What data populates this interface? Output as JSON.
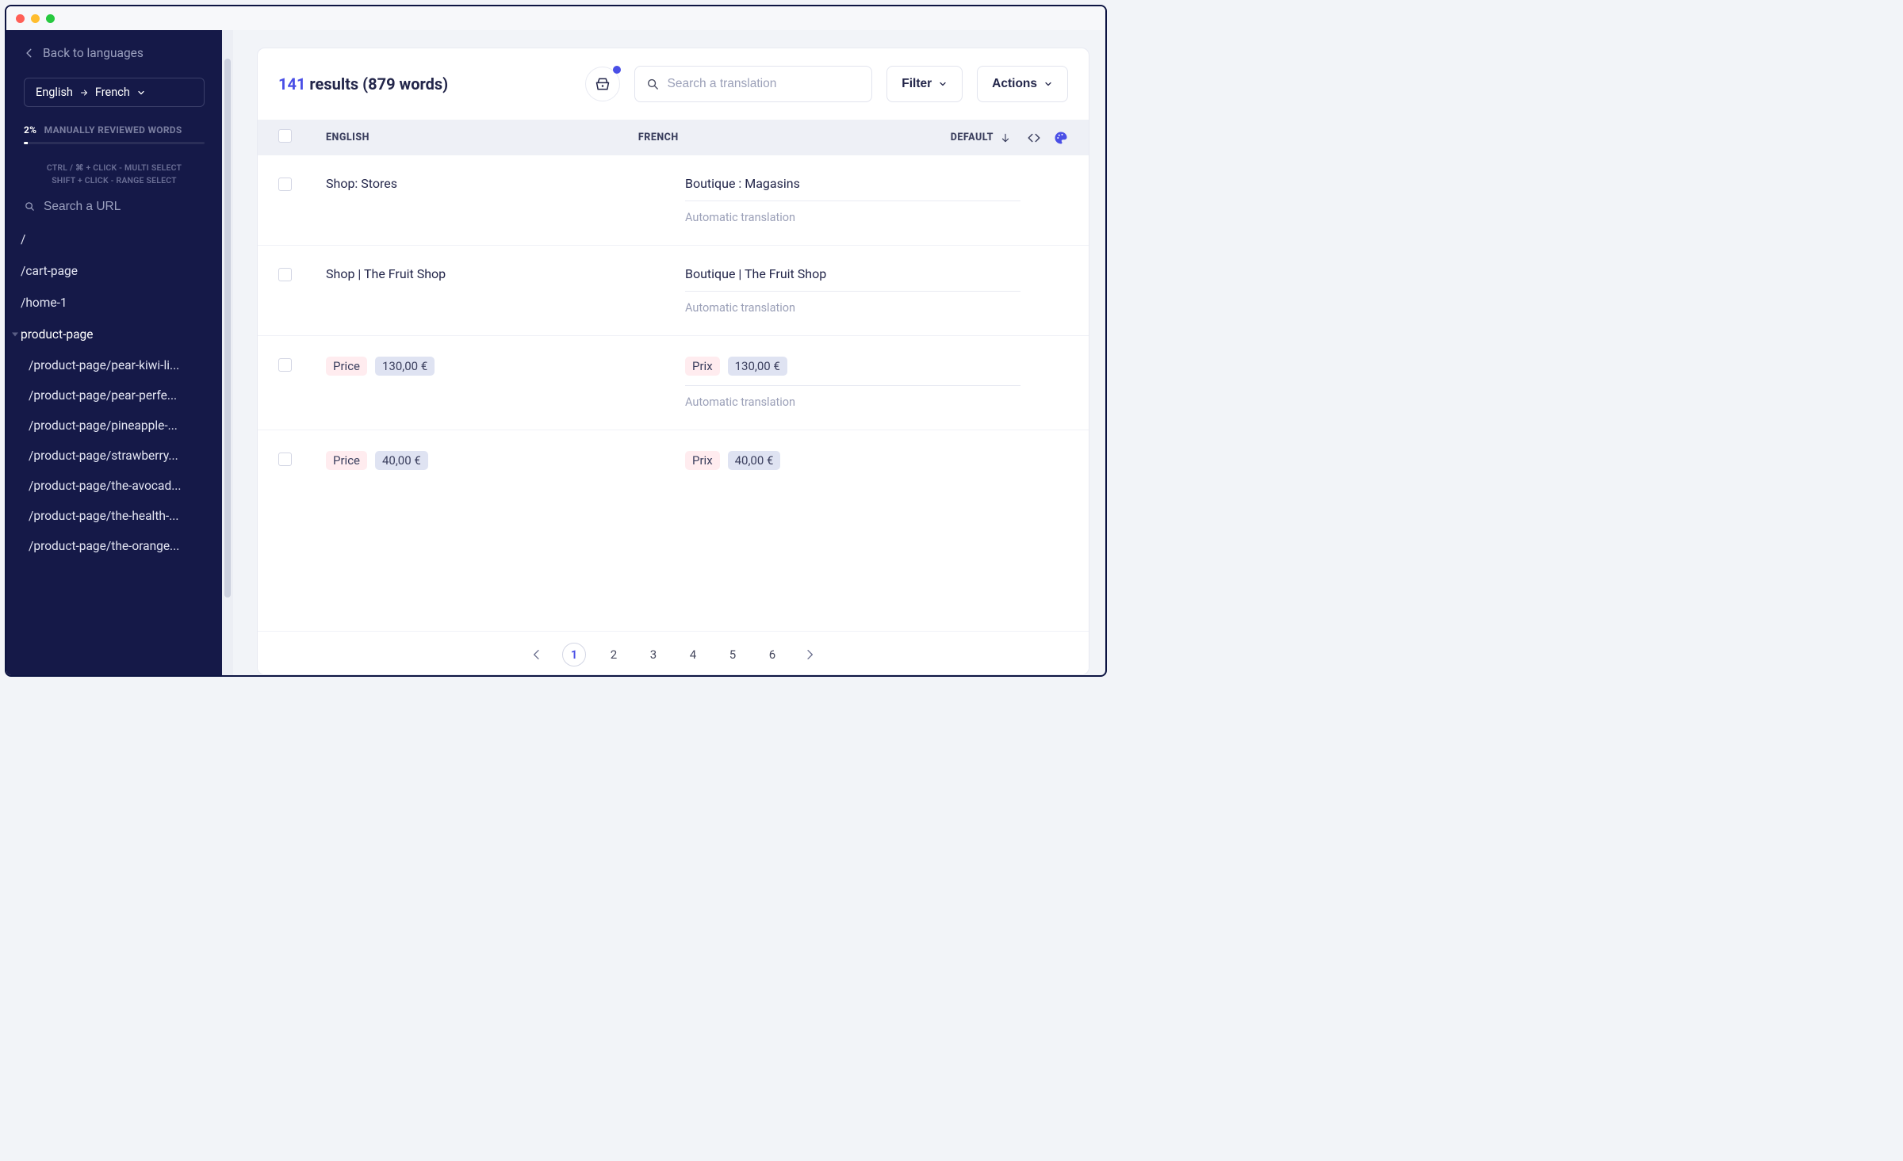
{
  "sidebar": {
    "back_label": "Back to languages",
    "lang_from": "English",
    "lang_to": "French",
    "progress_pct": "2%",
    "progress_label": "MANUALLY REVIEWED WORDS",
    "hint_line1": "CTRL / ⌘ + CLICK - MULTI SELECT",
    "hint_line2": "SHIFT + CLICK - RANGE SELECT",
    "url_search_placeholder": "Search a URL",
    "urls": [
      "/",
      "/cart-page",
      "/home-1"
    ],
    "expanded_label": "product-page",
    "children": [
      "/product-page/pear-kiwi-li...",
      "/product-page/pear-perfe...",
      "/product-page/pineapple-...",
      "/product-page/strawberry...",
      "/product-page/the-avocad...",
      "/product-page/the-health-...",
      "/product-page/the-orange..."
    ]
  },
  "header": {
    "count": "141",
    "results_text": "results (879 words)",
    "search_placeholder": "Search a translation",
    "filter_label": "Filter",
    "actions_label": "Actions"
  },
  "table": {
    "col_english": "ENGLISH",
    "col_french": "FRENCH",
    "col_default": "DEFAULT"
  },
  "rows": [
    {
      "en_text": "Shop: Stores",
      "fr_text": "Boutique : Magasins",
      "sub": "Automatic translation",
      "pill": false
    },
    {
      "en_text": "Shop | The Fruit Shop",
      "fr_text": "Boutique | The Fruit Shop",
      "sub": "Automatic translation",
      "pill": false
    },
    {
      "en_word": "Price",
      "en_num": "130,00 €",
      "fr_word": "Prix",
      "fr_num": "130,00 €",
      "sub": "Automatic translation",
      "pill": true
    },
    {
      "en_word": "Price",
      "en_num": "40,00 €",
      "fr_word": "Prix",
      "fr_num": "40,00 €",
      "sub": "",
      "pill": true
    }
  ],
  "pagination": {
    "pages": [
      "1",
      "2",
      "3",
      "4",
      "5",
      "6"
    ],
    "active": "1"
  }
}
